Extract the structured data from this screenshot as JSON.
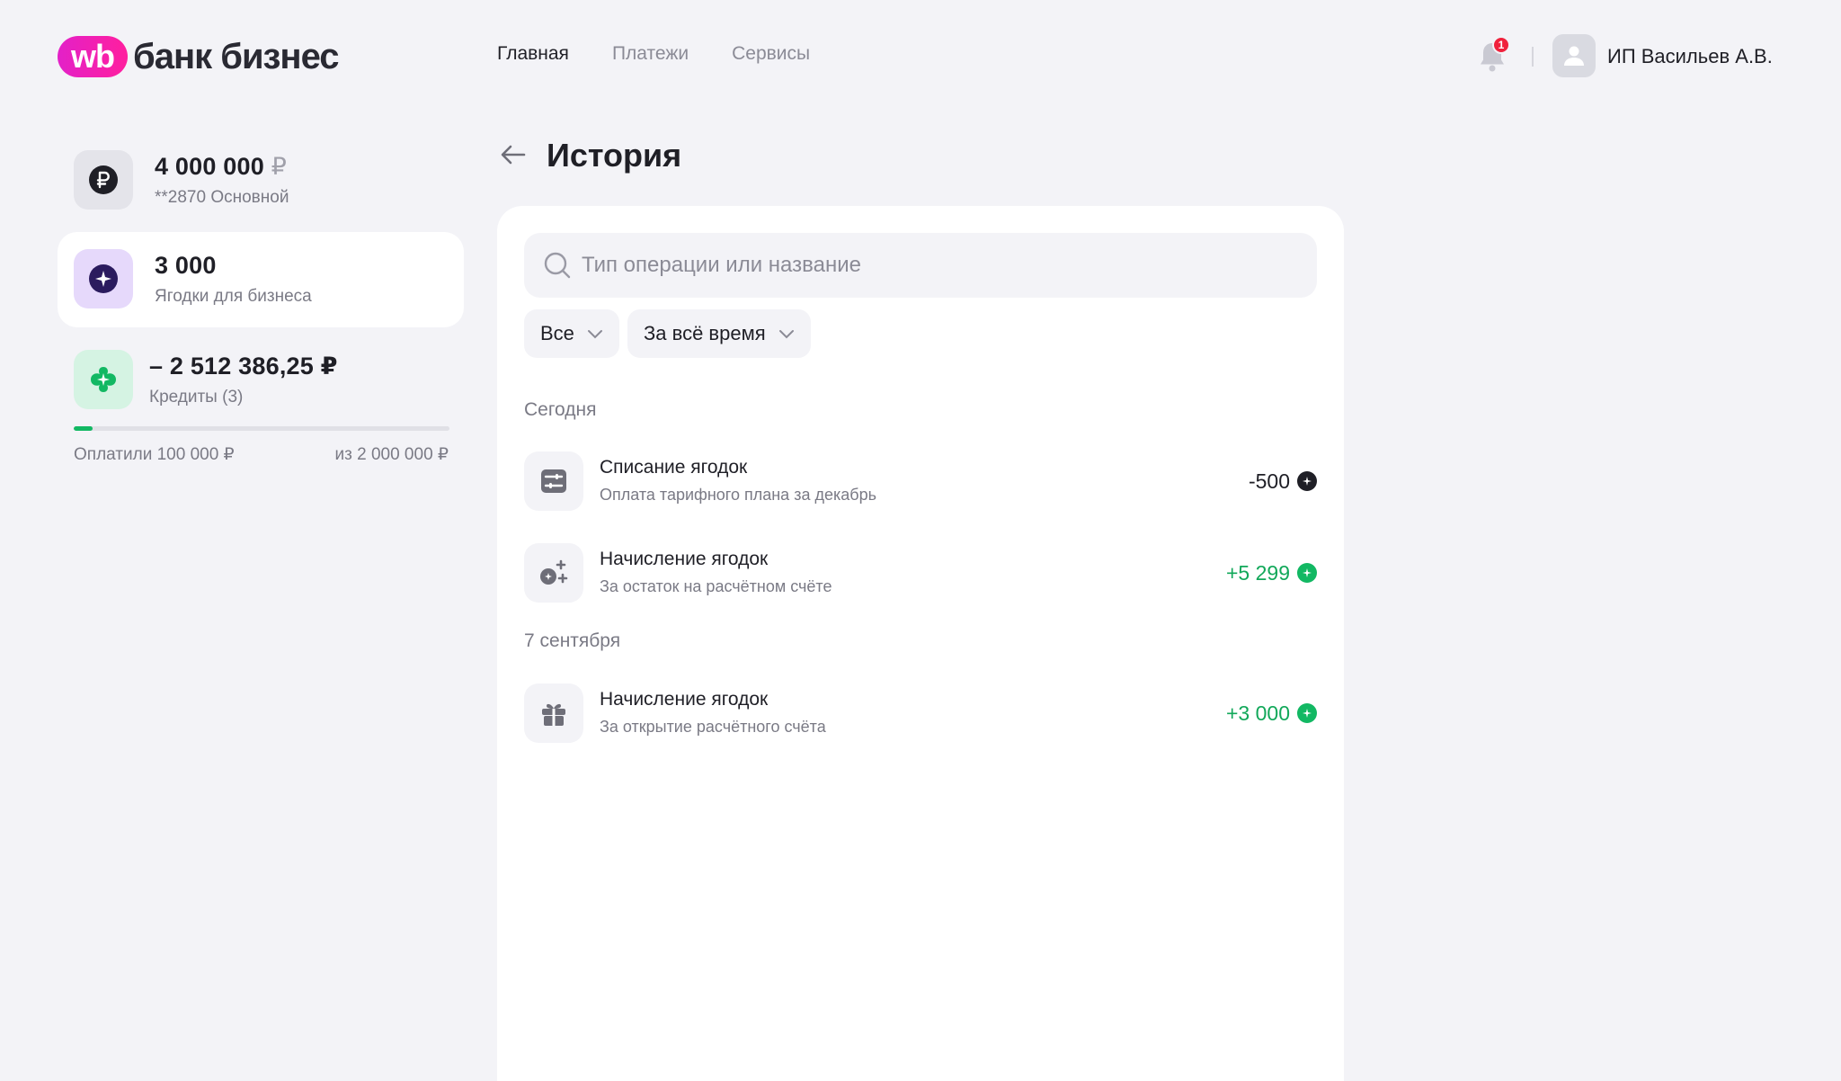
{
  "header": {
    "logo_mark": "wb",
    "logo_text": "банк бизнес",
    "nav": [
      {
        "label": "Главная",
        "active": true
      },
      {
        "label": "Платежи",
        "active": false
      },
      {
        "label": "Сервисы",
        "active": false
      }
    ],
    "notifications_count": "1",
    "user_name": "ИП Васильев А.В."
  },
  "sidebar": {
    "main_account": {
      "amount": "4 000 000",
      "currency": "₽",
      "sub": "**2870 Основной",
      "icon": "ruble-icon"
    },
    "berries": {
      "amount": "3 000",
      "sub": "Ягодки для бизнеса",
      "icon": "berry-star-icon"
    },
    "credits": {
      "amount": "– 2 512 386,25 ₽",
      "sub": "Кредиты (3)",
      "icon": "credit-icon",
      "paid_label": "Оплатили 100 000 ₽",
      "total_label": "из 2 000 000 ₽",
      "progress_percent": 5
    }
  },
  "main": {
    "title": "История",
    "search_placeholder": "Тип операции или название",
    "filters": [
      {
        "label": "Все"
      },
      {
        "label": "За всё время"
      }
    ],
    "sections": [
      {
        "label": "Сегодня",
        "transactions": [
          {
            "title": "Списание ягодок",
            "sub": "Оплата тарифного плана за декабрь",
            "amount": "-500",
            "type": "debit",
            "icon": "sliders-icon"
          },
          {
            "title": "Начисление ягодок",
            "sub": "За остаток на расчётном счёте",
            "amount": "+5 299",
            "type": "credit",
            "icon": "coins-plus-icon"
          }
        ]
      },
      {
        "label": "7 сентября",
        "transactions": [
          {
            "title": "Начисление ягодок",
            "sub": "За открытие расчётного счёта",
            "amount": "+3 000",
            "type": "credit",
            "icon": "gift-icon"
          }
        ]
      }
    ]
  },
  "colors": {
    "background": "#f3f3f7",
    "accent_pink": "#ff1f9e",
    "positive": "#12a85a",
    "badge": "#f0213c"
  }
}
